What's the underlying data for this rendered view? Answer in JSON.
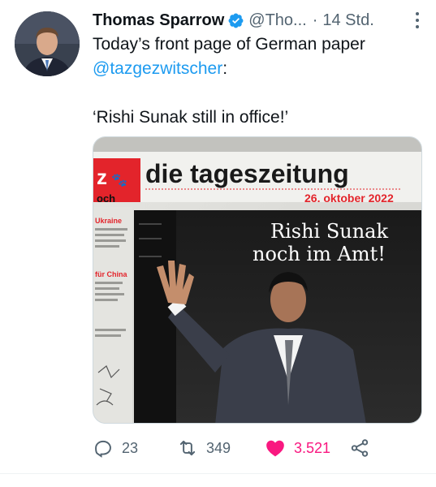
{
  "tweet": {
    "author_name": "Thomas Sparrow",
    "handle": "@Tho...",
    "separator": "·",
    "time": "14 Std.",
    "text_before": "Today’s front page of German paper ",
    "mention": "@tazgezwitscher",
    "text_after": ":",
    "quote": "‘Rishi Sunak still in office!’"
  },
  "newspaper": {
    "logo": "z",
    "masthead": "die tageszeitung",
    "date": "26. oktober 2022",
    "headline_line1": "Rishi Sunak",
    "headline_line2": "noch im Amt!",
    "sidebar_item1_title": "Ukraine",
    "sidebar_item2_title": "für China",
    "section_tag": "och"
  },
  "actions": {
    "reply_count": "23",
    "retweet_count": "349",
    "like_count": "3.521"
  },
  "colors": {
    "link": "#1d9bf0",
    "verified": "#1d9bf0",
    "like": "#f91880",
    "muted": "#536471",
    "taz_red": "#e3242b"
  },
  "icons": [
    "verified-badge-icon",
    "more-icon",
    "reply-icon",
    "retweet-icon",
    "heart-icon",
    "share-icon"
  ]
}
